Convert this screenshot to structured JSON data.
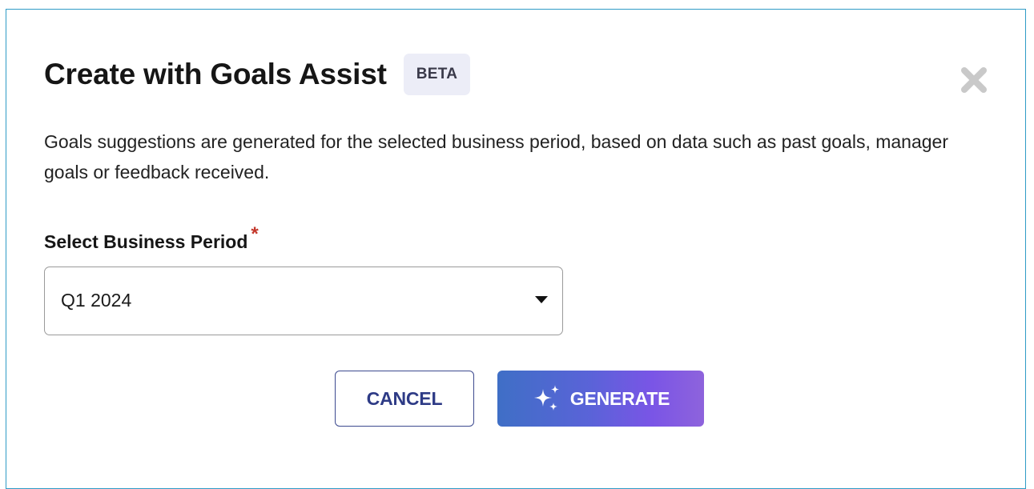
{
  "dialog": {
    "title": "Create with Goals Assist",
    "badge": "BETA",
    "close_icon": "close-icon",
    "description": "Goals suggestions are generated for the selected business period, based on data such as past goals, manager goals or feedback received."
  },
  "form": {
    "business_period": {
      "label": "Select Business Period",
      "required_mark": "*",
      "value": "Q1 2024",
      "caret_icon": "caret-down-icon"
    }
  },
  "actions": {
    "cancel_label": "CANCEL",
    "generate_label": "GENERATE",
    "generate_icon": "sparkle-icon"
  },
  "colors": {
    "dialog_border": "#2f9bc6",
    "required": "#c3372b",
    "cancel_text": "#2e3b86",
    "generate_gradient_start": "#3f6fc6",
    "generate_gradient_end": "#8e63dc",
    "badge_bg": "#ecedf7"
  }
}
